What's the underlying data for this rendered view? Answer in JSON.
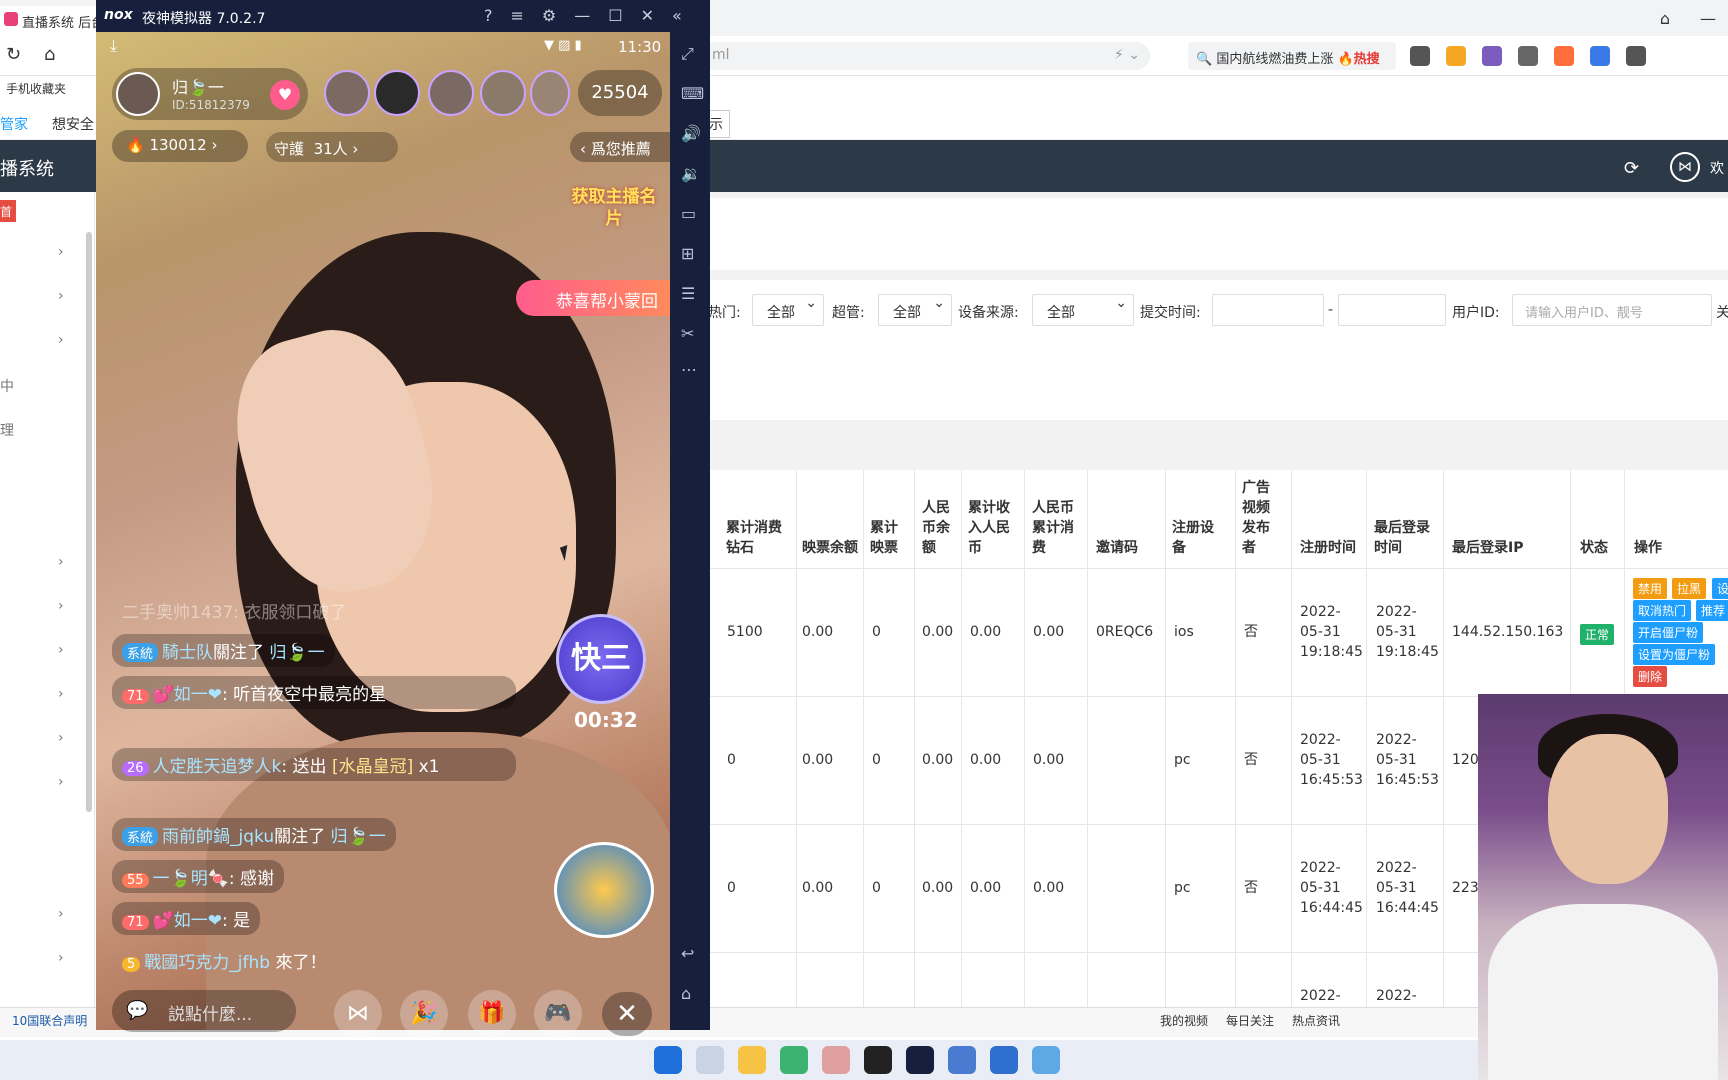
{
  "browser": {
    "tab_title": "直播系统 后台",
    "address_text": "ml",
    "hot_search_text": "国内航线燃油费上涨",
    "hot_search_badge": "🔥热搜",
    "bookmark": "手机收藏夹"
  },
  "admin_nav": {
    "item1": "管家",
    "item2": "想安全",
    "button": "示"
  },
  "admin": {
    "system_name": "播系统",
    "side_btn": "首",
    "side_letter1": "中",
    "side_letter2": "理",
    "welcome": "欢"
  },
  "filters": {
    "hot_label": "热门:",
    "hot_value": "全部",
    "super_label": "超管:",
    "super_value": "全部",
    "device_label": "设备来源:",
    "device_value": "全部",
    "time_label": "提交时间:",
    "time_sep": "-",
    "uid_label": "用户ID:",
    "uid_placeholder": "请输入用户ID、靓号",
    "more_label": "关"
  },
  "table": {
    "headers": [
      "累计消费钻石",
      "映票余额",
      "累计映票",
      "人民币余额",
      "累计收入人民币",
      "人民币累计消费",
      "邀请码",
      "注册设备",
      "广告视频发布者",
      "注册时间",
      "最后登录时间",
      "最后登录IP",
      "状态",
      "操作"
    ],
    "rows": [
      {
        "c1": "5100",
        "c2": "0.00",
        "c3": "0",
        "c4": "0.00",
        "c5": "0.00",
        "c6": "0.00",
        "c7": "0REQC6",
        "c8": "ios",
        "c9": "否",
        "c10": "2022-05-31 19:18:45",
        "c11": "2022-05-31 19:18:45",
        "c12": "144.52.150.163",
        "status": "正常"
      },
      {
        "c1": "0",
        "c2": "0.00",
        "c3": "0",
        "c4": "0.00",
        "c5": "0.00",
        "c6": "0.00",
        "c7": "",
        "c8": "pc",
        "c9": "否",
        "c10": "2022-05-31 16:45:53",
        "c11": "2022-05-31 16:45:53",
        "c12": "120"
      },
      {
        "c1": "0",
        "c2": "0.00",
        "c3": "0",
        "c4": "0.00",
        "c5": "0.00",
        "c6": "0.00",
        "c7": "",
        "c8": "pc",
        "c9": "否",
        "c10": "2022-05-31 16:44:45",
        "c11": "2022-05-31 16:44:45",
        "c12": "223"
      },
      {
        "c10": "2022-",
        "c11": "2022-"
      }
    ],
    "ops": {
      "ban": "禁用",
      "black": "拉黑",
      "set": "设",
      "cancel_hot": "取消热门",
      "recommend": "推荐",
      "open_zombie": "开启僵尸粉",
      "set_zombie": "设置为僵尸粉",
      "delete": "删除"
    }
  },
  "status_bar": {
    "news": "10国联合声明",
    "my_video": "我的视频",
    "daily_follow": "每日关注",
    "hot_news": "热点资讯"
  },
  "emulator": {
    "logo": "nox",
    "title": "夜神模拟器 7.0.2.7"
  },
  "live": {
    "time": "11:30",
    "host_name": "归🍃一",
    "host_id": "ID:51812379",
    "viewer_count": "25504",
    "hot_value": "130012",
    "guard": "守護",
    "guard_count": "31人",
    "recommend": "爲您推薦",
    "card_text": "获取主播名片",
    "congrats": "恭喜帮小蒙回",
    "chat_faded": "二手奥帅1437: 衣服领口破了",
    "chat1_tag": "系統",
    "chat1_name": "騎士队",
    "chat1_text": "關注了",
    "chat1_target": "归🍃一",
    "chat2_level": "71",
    "chat2_name": "💕如一❤",
    "chat2_text": ": 听首夜空中最亮的星",
    "chat3_level": "26",
    "chat3_name": "人定胜天追梦人k",
    "chat3_text": ": 送出",
    "chat3_gift": "[水晶皇冠]",
    "chat3_count": "x1",
    "chat4_tag": "系統",
    "chat4_name": "雨前帥鍋_jqku",
    "chat4_text": "關注了",
    "chat4_target": "归🍃一",
    "chat5_level": "55",
    "chat5_name": "一🍃明🍬",
    "chat5_text": ": 感谢",
    "chat6_level": "71",
    "chat6_name": "💕如一❤",
    "chat6_text": ": 是",
    "chat7_level": "5",
    "chat7_name": "戰國巧克力_jfhb",
    "chat7_text": "來了！",
    "pk_label": "快三",
    "pk_timer": "00:32",
    "input_placeholder": "説點什麼..."
  }
}
